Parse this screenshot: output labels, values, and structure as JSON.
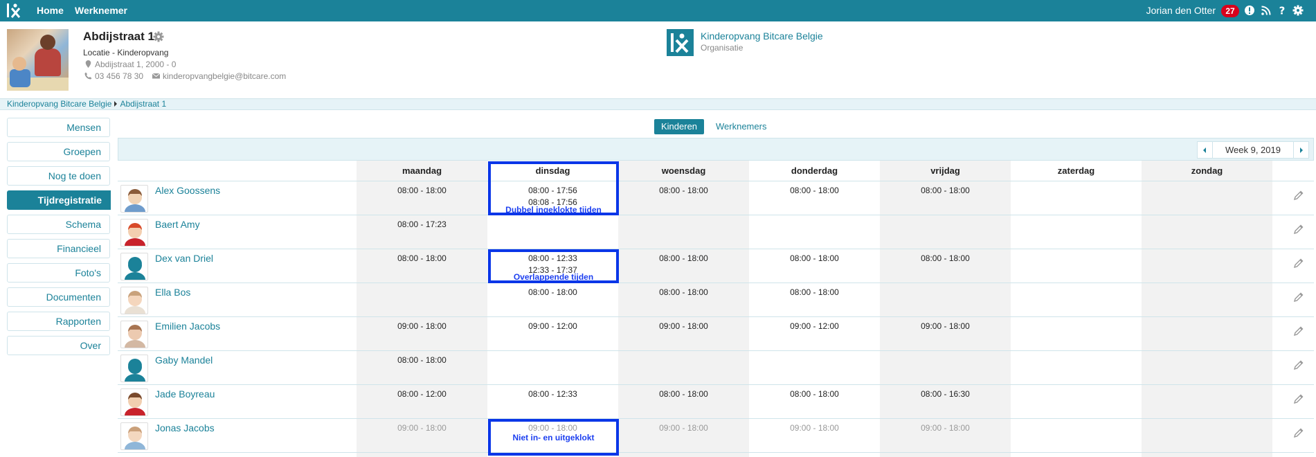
{
  "topbar": {
    "nav": [
      "Home",
      "Werknemer"
    ],
    "user": "Jorian den Otter",
    "badge_count": "27",
    "icons": [
      "alert-icon",
      "rss-icon",
      "help-icon",
      "gear-icon"
    ],
    "bg_color": "#1b8299"
  },
  "location": {
    "title": "Abdijstraat 1",
    "type": "Locatie - Kinderopvang",
    "address": "Abdijstraat 1, 2000 - 0",
    "phone": "03 456 78 30",
    "email": "kinderopvangbelgie@bitcare.com"
  },
  "organisation": {
    "name": "Kinderopvang Bitcare Belgie",
    "label": "Organisatie"
  },
  "breadcrumb": [
    "Kinderopvang Bitcare Belgie",
    "Abdijstraat 1"
  ],
  "sidebar": {
    "items": [
      {
        "label": "Mensen",
        "active": false
      },
      {
        "label": "Groepen",
        "active": false
      },
      {
        "label": "Nog te doen",
        "active": false
      },
      {
        "label": "Tijdregistratie",
        "active": true
      },
      {
        "label": "Schema",
        "active": false
      },
      {
        "label": "Financieel",
        "active": false
      },
      {
        "label": "Foto's",
        "active": false
      },
      {
        "label": "Documenten",
        "active": false
      },
      {
        "label": "Rapporten",
        "active": false
      },
      {
        "label": "Over",
        "active": false
      }
    ]
  },
  "tabs": [
    {
      "label": "Kinderen",
      "active": true
    },
    {
      "label": "Werknemers",
      "active": false
    }
  ],
  "week": {
    "label": "Week 9, 2019"
  },
  "days": [
    "maandag",
    "dinsdag",
    "woensdag",
    "donderdag",
    "vrijdag",
    "zaterdag",
    "zondag"
  ],
  "children": [
    {
      "name": "Alex Goossens",
      "times": [
        [
          "08:00 - 18:00"
        ],
        [
          "08:00 - 17:56",
          "08:08 - 17:56"
        ],
        [
          "08:00 - 18:00"
        ],
        [
          "08:00 - 18:00"
        ],
        [
          "08:00 - 18:00"
        ],
        [],
        []
      ]
    },
    {
      "name": "Baert Amy",
      "times": [
        [
          "08:00 - 17:23"
        ],
        [],
        [],
        [],
        [],
        [],
        []
      ]
    },
    {
      "name": "Dex van Driel",
      "times": [
        [
          "08:00 - 18:00"
        ],
        [
          "08:00 - 12:33",
          "12:33 - 17:37"
        ],
        [
          "08:00 - 18:00"
        ],
        [
          "08:00 - 18:00"
        ],
        [
          "08:00 - 18:00"
        ],
        [],
        []
      ]
    },
    {
      "name": "Ella Bos",
      "times": [
        [],
        [
          "08:00 - 18:00"
        ],
        [
          "08:00 - 18:00"
        ],
        [
          "08:00 - 18:00"
        ],
        [],
        [],
        []
      ]
    },
    {
      "name": "Emilien Jacobs",
      "times": [
        [
          "09:00 - 18:00"
        ],
        [
          "09:00 - 12:00"
        ],
        [
          "09:00 - 18:00"
        ],
        [
          "09:00 - 12:00"
        ],
        [
          "09:00 - 18:00"
        ],
        [],
        []
      ]
    },
    {
      "name": "Gaby Mandel",
      "times": [
        [
          "08:00 - 18:00"
        ],
        [],
        [],
        [],
        [],
        [],
        []
      ]
    },
    {
      "name": "Jade Boyreau",
      "times": [
        [
          "08:00 - 12:00"
        ],
        [
          "08:00 - 12:33"
        ],
        [
          "08:00 - 18:00"
        ],
        [
          "08:00 - 18:00"
        ],
        [
          "08:00 - 16:30"
        ],
        [],
        []
      ]
    },
    {
      "name": "Jonas Jacobs",
      "muted": true,
      "times": [
        [
          "09:00 - 18:00"
        ],
        [
          "09:00 - 18:00"
        ],
        [
          "09:00 - 18:00"
        ],
        [
          "09:00 - 18:00"
        ],
        [
          "09:00 - 18:00"
        ],
        [],
        []
      ]
    }
  ],
  "annotations": [
    {
      "label": "Dubbel ingeklokte tijden",
      "row": 0
    },
    {
      "label": "Overlappende tijden",
      "row": 2
    },
    {
      "label": "Niet in- en uitgeklokt",
      "row": 7
    }
  ],
  "colors": {
    "accent": "#1b8299",
    "highlight": "#0a36e8",
    "badge": "#d9001b"
  }
}
